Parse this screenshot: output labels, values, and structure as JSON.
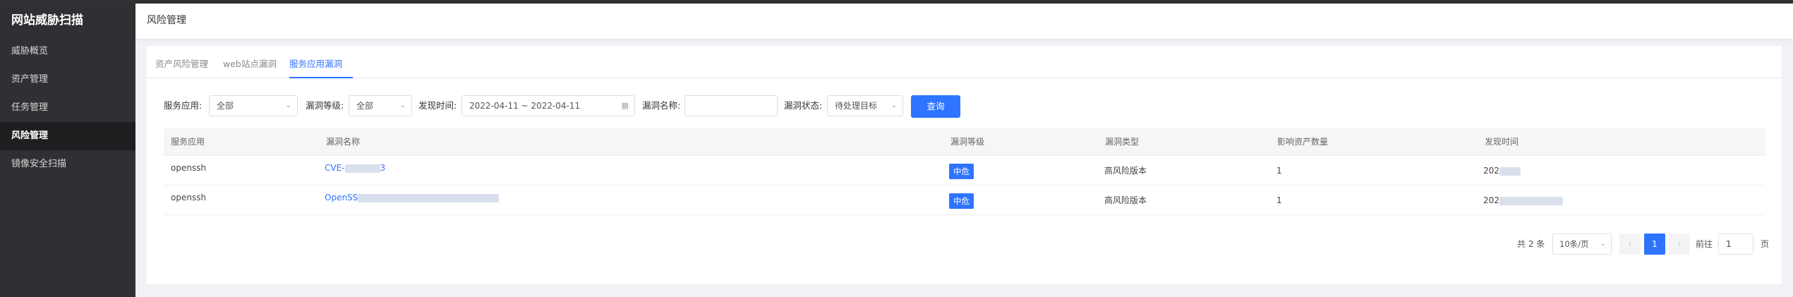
{
  "sidebar": {
    "logo": "网站威胁扫描",
    "items": [
      {
        "label": "威胁概览"
      },
      {
        "label": "资产管理"
      },
      {
        "label": "任务管理"
      },
      {
        "label": "风险管理"
      },
      {
        "label": "镜像安全扫描"
      }
    ],
    "active_index": 3
  },
  "header": {
    "title": "风险管理"
  },
  "tabs": [
    {
      "label": "资产风险管理"
    },
    {
      "label": "web站点漏洞"
    },
    {
      "label": "服务应用漏洞"
    }
  ],
  "filters": {
    "service_label": "服务应用:",
    "service_value": "全部",
    "level_label": "漏洞等级:",
    "level_value": "全部",
    "time_label": "发现时间:",
    "time_value": "2022-04-11 ~ 2022-04-11",
    "name_label": "漏洞名称:",
    "name_value": "",
    "status_label": "漏洞状态:",
    "status_value": "待处理目标",
    "query_label": "查询"
  },
  "table": {
    "columns": [
      "服务应用",
      "漏洞名称",
      "漏洞等级",
      "漏洞类型",
      "影响资产数量",
      "发现时间"
    ],
    "rows": [
      {
        "service": "openssh",
        "name": "CVE-",
        "name_tail": "3",
        "level": "中危",
        "type": "高风险版本",
        "assets": "1",
        "time": "202"
      },
      {
        "service": "openssh",
        "name": "OpenSS",
        "name_tail": "",
        "level": "中危",
        "type": "高风险版本",
        "assets": "1",
        "time": "202"
      }
    ]
  },
  "pagination": {
    "total": "共 2 条",
    "page_size": "10条/页",
    "prev": "‹",
    "current": "1",
    "next": "›",
    "goto_label": "前往",
    "goto_value": "1",
    "page_suffix": "页"
  },
  "colors": {
    "accent": "#2f74ff",
    "sidebar": "#2f3033"
  }
}
